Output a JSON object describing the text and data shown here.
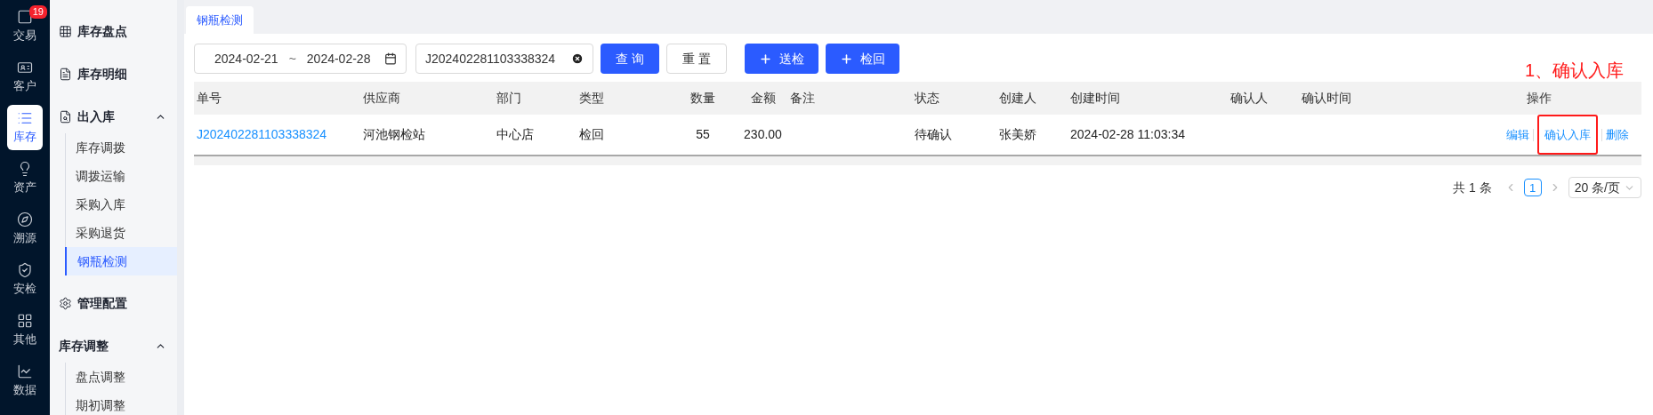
{
  "nav": [
    {
      "label": "交易",
      "selected": false,
      "badge": "19"
    },
    {
      "label": "客户",
      "selected": false
    },
    {
      "label": "库存",
      "selected": true
    },
    {
      "label": "资产",
      "selected": false
    },
    {
      "label": "溯源",
      "selected": false
    },
    {
      "label": "安检",
      "selected": false
    },
    {
      "label": "其他",
      "selected": false
    },
    {
      "label": "数据",
      "selected": false
    }
  ],
  "sidebar": {
    "items": [
      {
        "kind": "link",
        "label": "库存盘点"
      },
      {
        "kind": "link",
        "label": "库存明细"
      },
      {
        "kind": "group",
        "label": "出入库",
        "expanded": true,
        "children": [
          {
            "label": "库存调拨",
            "selected": false
          },
          {
            "label": "调拨运输",
            "selected": false
          },
          {
            "label": "采购入库",
            "selected": false
          },
          {
            "label": "采购退货",
            "selected": false
          },
          {
            "label": "钢瓶检测",
            "selected": true
          }
        ]
      },
      {
        "kind": "link",
        "label": "管理配置"
      },
      {
        "kind": "group",
        "label": "库存调整",
        "expanded": true,
        "children": [
          {
            "label": "盘点调整",
            "selected": false
          },
          {
            "label": "期初调整",
            "selected": false
          }
        ]
      }
    ]
  },
  "tabs": [
    {
      "label": "钢瓶检测",
      "selected": true
    }
  ],
  "filters": {
    "date_from": "2024-02-21",
    "date_separator": "~",
    "date_to": "2024-02-28",
    "order_number": "J202402281103338324"
  },
  "buttons": [
    {
      "label": "查 询",
      "kind": "primary"
    },
    {
      "label": "重 置",
      "kind": "default"
    },
    {
      "label": "送检",
      "kind": "add"
    },
    {
      "label": "检回",
      "kind": "add"
    }
  ],
  "table": {
    "columns": [
      "单号",
      "供应商",
      "部门",
      "类型",
      "数量",
      "金额",
      "备注",
      "状态",
      "创建人",
      "创建时间",
      "确认人",
      "确认时间",
      "操作"
    ],
    "rows": [
      {
        "cells": [
          "J202402281103338324",
          "河池钢检站",
          "中心店",
          "检回",
          "55",
          "230.00",
          "",
          "待确认",
          "张美娇",
          "2024-02-28 11:03:34",
          "",
          ""
        ],
        "actions": [
          {
            "label": "编辑",
            "highlighted": false
          },
          {
            "label": "确认入库",
            "highlighted": true
          },
          {
            "label": "删除",
            "highlighted": false
          }
        ]
      }
    ]
  },
  "annotation": "1、确认入库",
  "pagination": {
    "total": "共 1 条",
    "pages": [
      {
        "label": "1",
        "selected": true
      }
    ],
    "page_size": "20 条/页"
  }
}
